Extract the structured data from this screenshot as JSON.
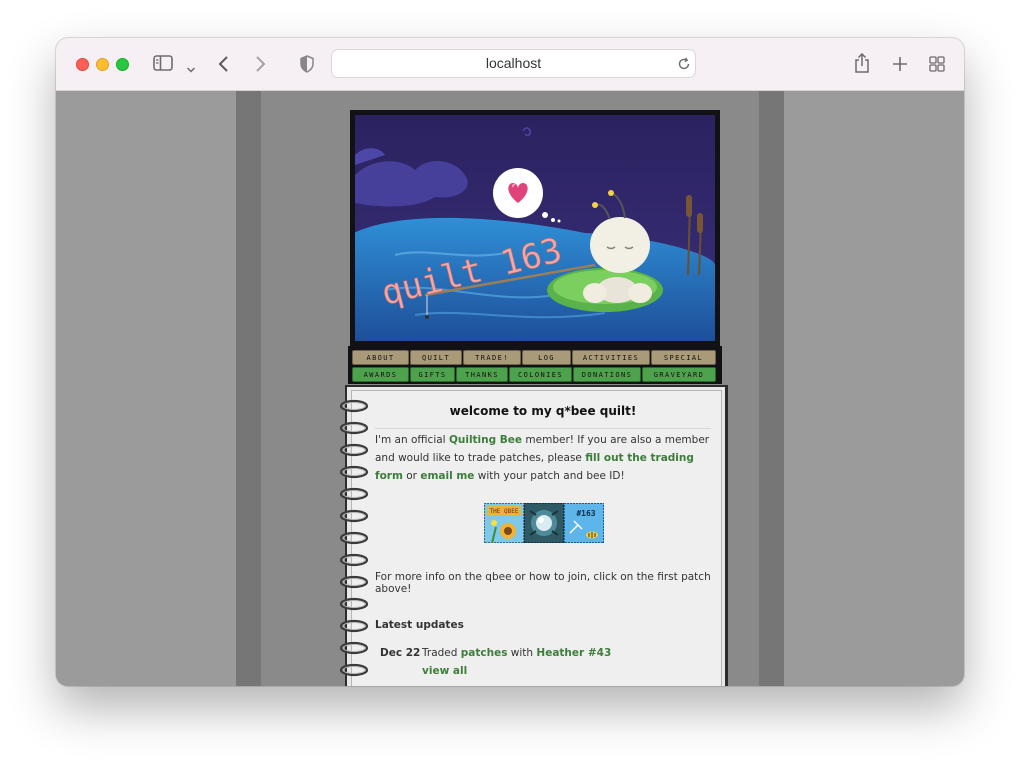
{
  "browser": {
    "url": "localhost"
  },
  "banner": {
    "caption": "quilt 163"
  },
  "nav": {
    "row1": [
      "about",
      "quilt",
      "trade!",
      "log",
      "activities",
      "special"
    ],
    "row2": [
      "awards",
      "gifts",
      "thanks",
      "colonies",
      "donations",
      "graveyard"
    ]
  },
  "page": {
    "title": "welcome to my q*bee quilt!",
    "intro_1": "I'm an official ",
    "intro_link_1": "Quilting Bee",
    "intro_2": " member! If you are also a member and would like to trade patches, please ",
    "intro_link_2": "fill out the trading form",
    "intro_3": " or ",
    "intro_link_3": "email me",
    "intro_4": " with your patch and bee ID!",
    "patches": [
      {
        "icon": "qbee-sunflower-patch",
        "label": "THE QBEE"
      },
      {
        "icon": "orb-patch",
        "label": ""
      },
      {
        "icon": "snowflake-163-patch",
        "label": "#163"
      }
    ],
    "more_info": "For more info on the qbee or how to join, click on the first patch above!",
    "latest_heading": "Latest updates",
    "updates": [
      {
        "date": "Dec 22",
        "text_1": "Traded ",
        "link_1": "patches",
        "text_2": " with ",
        "link_2": "Heather #43"
      }
    ],
    "view_all": "view all"
  },
  "colors": {
    "link": "#3c7d3a",
    "nav_tan": "#a99b7a",
    "nav_green": "#4fa24d",
    "page_bg": "#9b9b9b"
  }
}
